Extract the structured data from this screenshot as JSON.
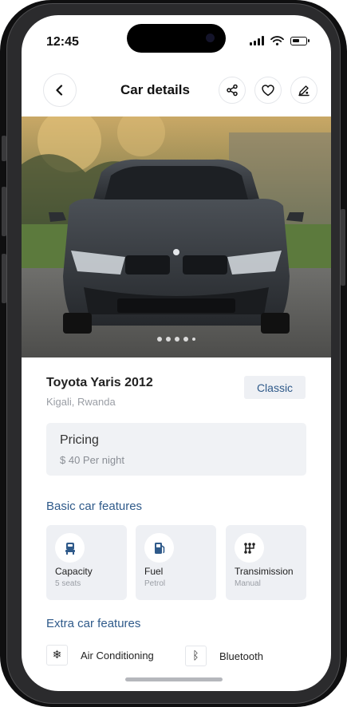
{
  "status": {
    "time": "12:45"
  },
  "header": {
    "title": "Car details",
    "back_icon": "chevron-left-icon",
    "actions": [
      "share-icon",
      "heart-icon",
      "edit-icon"
    ]
  },
  "gallery": {
    "photo": "dark grey sedan car photo",
    "page_count": 5,
    "current_page": 1
  },
  "car": {
    "name": "Toyota Yaris 2012",
    "location": "Kigali, Rwanda",
    "class": "Classic"
  },
  "pricing": {
    "title": "Pricing",
    "value": "$ 40 Per night"
  },
  "basic_features": {
    "title": "Basic car features",
    "items": [
      {
        "label": "Capacity",
        "value": "5 seats",
        "icon": "car-seat-icon"
      },
      {
        "label": "Fuel",
        "value": "Petrol",
        "icon": "fuel-pump-icon"
      },
      {
        "label": "Transimission",
        "value": "Manual",
        "icon": "gearbox-icon"
      }
    ]
  },
  "extra_features": {
    "title": "Extra car features",
    "items": [
      {
        "label": "Air Conditioning",
        "icon": "snowflake-icon",
        "glyph": "❄"
      },
      {
        "label": "Bluetooth",
        "icon": "bluetooth-icon",
        "glyph": "ᛒ"
      }
    ]
  },
  "colors": {
    "accent": "#2f5a8a",
    "card_bg": "#eef0f4",
    "muted_text": "#9a9ea5"
  }
}
